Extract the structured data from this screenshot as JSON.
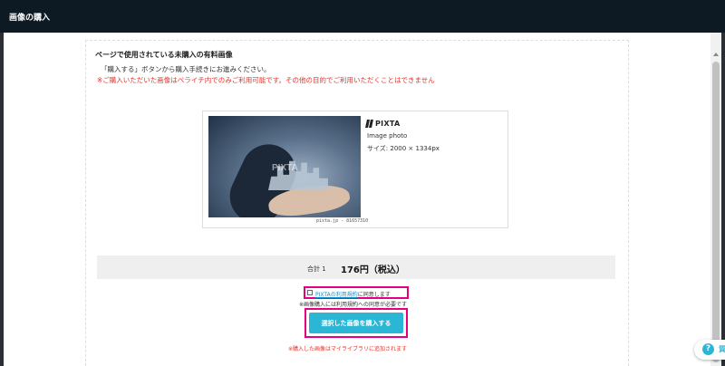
{
  "modal": {
    "title": "画像の購入"
  },
  "section": {
    "heading": "ページで使用されている未購入の有料画像",
    "instruction": "「購入する」ボタンから購入手続きにお進みください。",
    "warning": "※ご購入いただいた画像はペライチ内でのみご利用可能です。その他の目的でご利用いただくことはできません"
  },
  "image": {
    "watermark": "PIXTA",
    "credit": "pixta.jp - 81657310",
    "brand": "PIXTA",
    "type": "Image photo",
    "size": "サイズ: 2000 × 1334px"
  },
  "total": {
    "label": "合計 1",
    "price": "176円（税込）"
  },
  "agreement": {
    "link": "PIXTAの利用規約",
    "suffix": "に同意します",
    "note": "※画像購入には利用規約への同意が必要です"
  },
  "buy_button": "選択した画像を購入する",
  "library_note": "※購入した画像はマイライブラリに追加されます",
  "help": {
    "label": "質"
  },
  "colors": {
    "accent": "#2bb6d6",
    "highlight": "#e4007f",
    "warning": "#e8332a",
    "header": "#0d1a24"
  }
}
